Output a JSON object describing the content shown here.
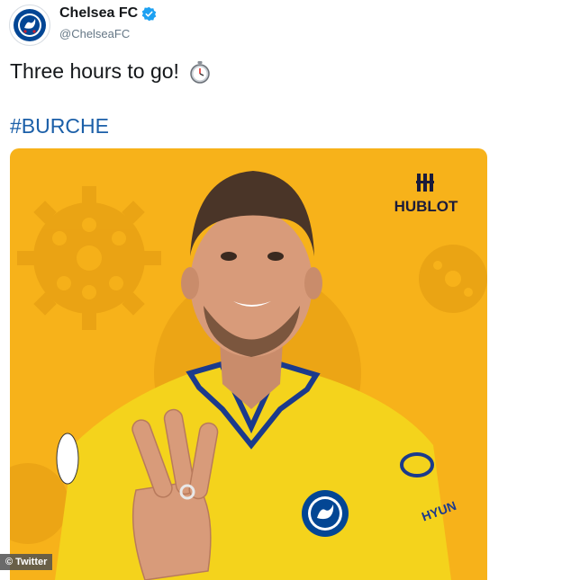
{
  "tweet": {
    "author_name": "Chelsea FC",
    "handle": "@ChelseaFC",
    "text": "Three hours to go!",
    "emoji_icon": "stopwatch-icon",
    "hashtag": "#BURCHE"
  },
  "media": {
    "background_color": "#f7b21a",
    "sponsor_logo": "HUBLOT",
    "shirt_sponsor": "HYUNDAI",
    "gesture": "three fingers raised"
  },
  "credit": "© Twitter",
  "colors": {
    "hashtag": "#1b5fa8",
    "verified": "#1da1f2",
    "chelsea_blue": "#034694",
    "gear": "#e59e12"
  }
}
